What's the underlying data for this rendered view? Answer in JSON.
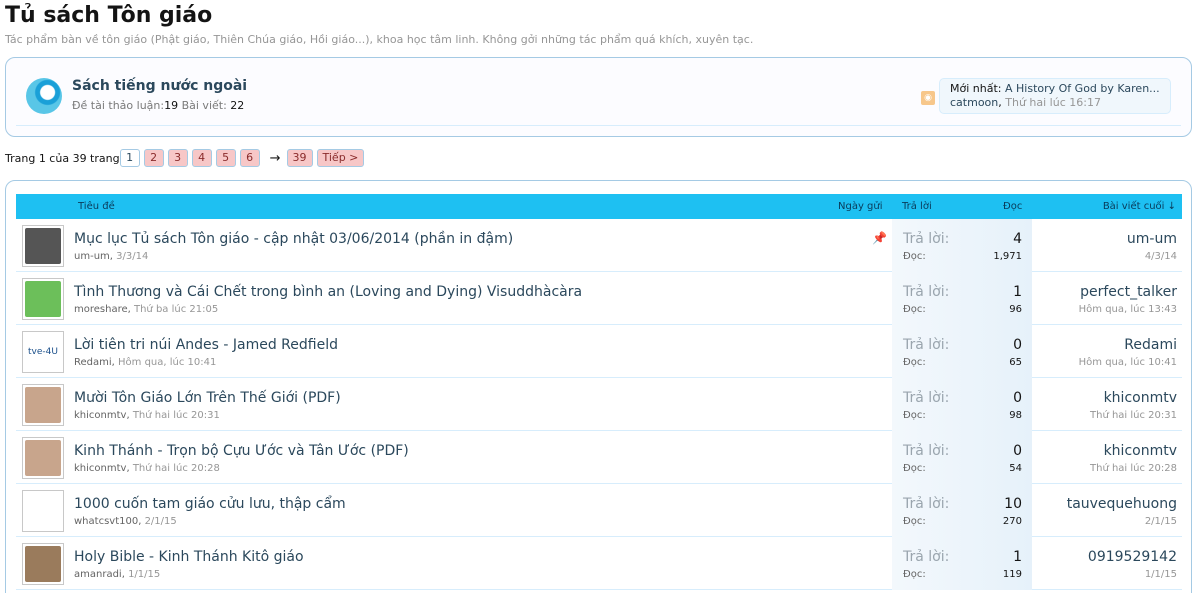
{
  "page": {
    "title": "Tủ sách Tôn giáo",
    "description": "Tác phẩm bàn về tôn giáo (Phật giáo, Thiên Chúa giáo, Hồi giáo...), khoa học tâm linh. Không gởi những tác phẩm quá khích, xuyên tạc."
  },
  "subforum": {
    "title": "Sách tiếng nước ngoài",
    "threads_label": "Đề tài thảo luận:",
    "threads_value": "19",
    "posts_label": "Bài viết:",
    "posts_value": "22",
    "latest_label": "Mới nhất:",
    "latest_title": "A History Of God by Karen...",
    "latest_user": "catmoon",
    "latest_time": "Thứ hai lúc 16:17",
    "rss_icon": "rss-icon"
  },
  "pager": {
    "label": "Trang 1 của 39 trang",
    "pages": [
      "1",
      "2",
      "3",
      "4",
      "5",
      "6"
    ],
    "arrow": "→",
    "last": "39",
    "next": "Tiếp >"
  },
  "table_header": {
    "title": "Tiêu đề",
    "date": "Ngày gửi",
    "replies": "Trả lời",
    "views": "Đọc",
    "last_post": "Bài viết cuối ↓"
  },
  "threads": [
    {
      "title": "Mục lục Tủ sách Tôn giáo - cập nhật 03/06/2014 (phần in đậm)",
      "author": "um-um",
      "date": "3/3/14",
      "replies_label": "Trả lời:",
      "replies": "4",
      "views_label": "Đọc:",
      "views": "1,971",
      "last_user": "um-um",
      "last_time": "4/3/14",
      "sticky": true,
      "avatar_color": "#555555"
    },
    {
      "title": "Tình Thương và Cái Chết trong bình an (Loving and Dying) Visuddhàcàra",
      "author": "moreshare",
      "date": "Thứ ba lúc 21:05",
      "replies_label": "Trả lời:",
      "replies": "1",
      "views_label": "Đọc:",
      "views": "96",
      "last_user": "perfect_talker",
      "last_time": "Hôm qua, lúc 13:43",
      "sticky": false,
      "avatar_color": "#6cbf5a"
    },
    {
      "title": "Lời tiên tri núi Andes - Jamed Redfield",
      "author": "Redami",
      "date": "Hôm qua, lúc 10:41",
      "replies_label": "Trả lời:",
      "replies": "0",
      "views_label": "Đọc:",
      "views": "65",
      "last_user": "Redami",
      "last_time": "Hôm qua, lúc 10:41",
      "sticky": false,
      "avatar_color": "#ffffff",
      "avatar_text": "tve-4U"
    },
    {
      "title": "Mười Tôn Giáo Lớn Trên Thế Giới (PDF)",
      "author": "khiconmtv",
      "date": "Thứ hai lúc 20:31",
      "replies_label": "Trả lời:",
      "replies": "0",
      "views_label": "Đọc:",
      "views": "98",
      "last_user": "khiconmtv",
      "last_time": "Thứ hai lúc 20:31",
      "sticky": false,
      "avatar_color": "#c8a58c"
    },
    {
      "title": "Kinh Thánh - Trọn bộ Cựu Ước và Tân Ước (PDF)",
      "author": "khiconmtv",
      "date": "Thứ hai lúc 20:28",
      "replies_label": "Trả lời:",
      "replies": "0",
      "views_label": "Đọc:",
      "views": "54",
      "last_user": "khiconmtv",
      "last_time": "Thứ hai lúc 20:28",
      "sticky": false,
      "avatar_color": "#c8a58c"
    },
    {
      "title": "1000 cuốn tam giáo cửu lưu, thập cẩm",
      "author": "whatcsvt100",
      "date": "2/1/15",
      "replies_label": "Trả lời:",
      "replies": "10",
      "views_label": "Đọc:",
      "views": "270",
      "last_user": "tauvequehuong",
      "last_time": "2/1/15",
      "sticky": false,
      "avatar_color": "#ffffff"
    },
    {
      "title": "Holy Bible - Kinh Thánh Kitô giáo",
      "author": "amanradi",
      "date": "1/1/15",
      "replies_label": "Trả lời:",
      "replies": "1",
      "views_label": "Đọc:",
      "views": "119",
      "last_user": "0919529142",
      "last_time": "1/1/15",
      "sticky": false,
      "avatar_color": "#9a7b5c"
    }
  ]
}
